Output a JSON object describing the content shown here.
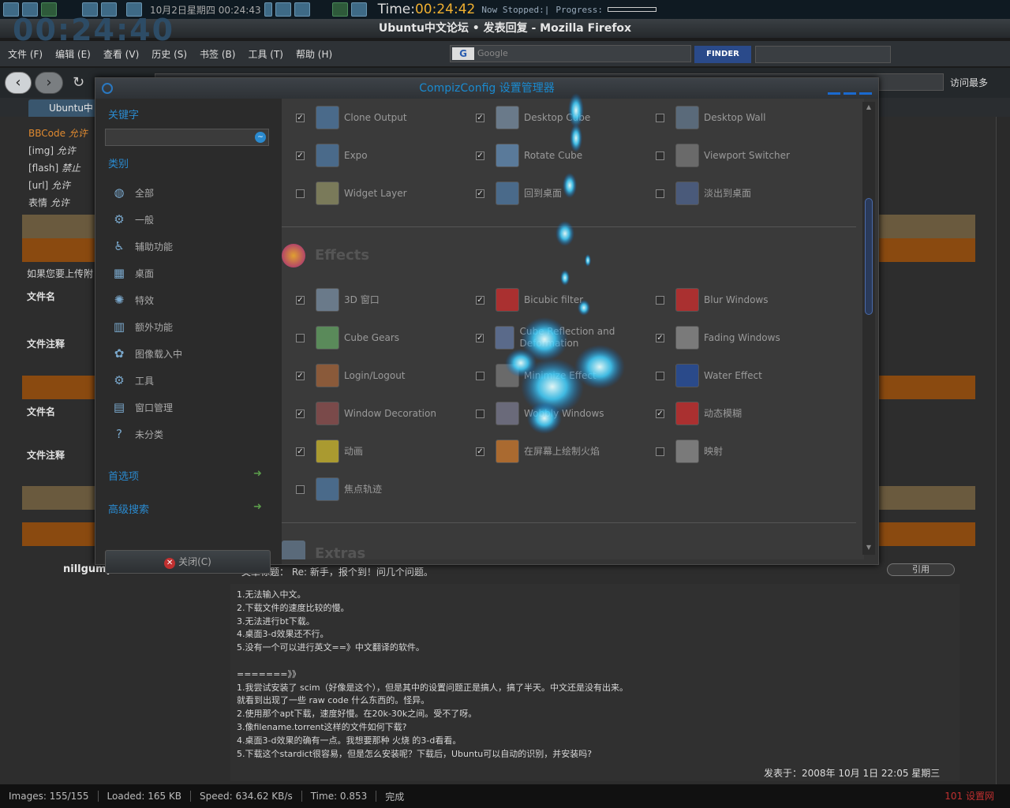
{
  "sys": {
    "clock": "10月2日星期四 00:24:43",
    "time_label": "Time:",
    "time_value": "00:24:42",
    "status": "Now Stopped:|",
    "progress_label": "Progress:"
  },
  "firefox": {
    "title": "Ubuntu中文论坛 • 发表回复 - Mozilla Firefox",
    "bg_clock": "00:24:40",
    "menu": [
      "文件 (F)",
      "编辑 (E)",
      "查看 (V)",
      "历史 (S)",
      "书签 (B)",
      "工具 (T)",
      "帮助 (H)"
    ],
    "search_placeholder": "Google",
    "finder_label": "FINDER",
    "visit_label": "访问最多",
    "tab_label": "Ubuntu中"
  },
  "page": {
    "left_lines": [
      {
        "tag": "BBCode",
        "state": "允许"
      },
      {
        "tag": "[img]",
        "state": "允许"
      },
      {
        "tag": "[flash]",
        "state": "禁止"
      },
      {
        "tag": "[url]",
        "state": "允许"
      },
      {
        "tag": "表情",
        "state": "允许"
      }
    ],
    "upload_prompt": "如果您要上传附",
    "filename_label": "文件名",
    "filenote_label": "文件注释",
    "author": "nillgump",
    "subject": "文章标题： Re: 新手，报个到！问几个问题。",
    "quote_label": "引用",
    "post_lines": [
      "1.无法输入中文。",
      "2.下载文件的速度比较的慢。",
      "3.无法进行bt下载。",
      "4.桌面3-d效果还不行。",
      "5.没有一个可以进行英文==》中文翻译的软件。",
      "",
      "=======》》",
      "1.我尝试安装了 scim（好像是这个），但是其中的设置问题正是搞人，搞了半天。中文还是没有出来。",
      "就看到出现了一些 raw code 什么东西的。怪异。",
      "2.使用那个apt下载，速度好慢。在20k-30k之间。受不了呀。",
      "3.像filename.torrent这样的文件如何下载?",
      "4.桌面3-d效果的确有一点。我想要那种 火烧 的3-d看看。",
      "5.下载这个stardict很容易，但是怎么安装呢？下载后，Ubuntu可以自动的识别，并安装吗?"
    ],
    "posted": "发表于：2008年 10月 1日 22:05 星期三"
  },
  "statusbar": {
    "images": "Images: 155/155",
    "loaded": "Loaded: 165 KB",
    "speed": "Speed: 634.62 KB/s",
    "time": "Time: 0.853",
    "done": "完成",
    "right": "101 设置网"
  },
  "ccsm": {
    "title": "CompizConfig 设置管理器",
    "keyword_label": "关键字",
    "category_label": "类别",
    "categories": [
      {
        "label": "全部",
        "icon": "globe-icon",
        "glyph": "◍"
      },
      {
        "label": "一般",
        "icon": "gear-icon",
        "glyph": "⚙"
      },
      {
        "label": "辅助功能",
        "icon": "accessibility-icon",
        "glyph": "♿"
      },
      {
        "label": "桌面",
        "icon": "desktop-icon",
        "glyph": "▦"
      },
      {
        "label": "特效",
        "icon": "effects-icon",
        "glyph": "✺"
      },
      {
        "label": "额外功能",
        "icon": "extras-icon",
        "glyph": "▥"
      },
      {
        "label": "图像载入中",
        "icon": "image-loading-icon",
        "glyph": "✿"
      },
      {
        "label": "工具",
        "icon": "tools-icon",
        "glyph": "⚙"
      },
      {
        "label": "窗口管理",
        "icon": "window-management-icon",
        "glyph": "▤"
      },
      {
        "label": "未分类",
        "icon": "question-icon",
        "glyph": "?"
      }
    ],
    "preferences_label": "首选项",
    "advanced_search_label": "高级搜索",
    "close_label": "关闭(C)",
    "section_effects": "Effects",
    "section_extras": "Extras",
    "plugins": [
      {
        "label": "Clone Output",
        "checked": true,
        "color": "#4a6a8a"
      },
      {
        "label": "Desktop Cube",
        "checked": true,
        "color": "#6a7a8a"
      },
      {
        "label": "Desktop Wall",
        "checked": false,
        "color": "#5a6a7a"
      },
      {
        "label": "Expo",
        "checked": true,
        "color": "#4a6a8a"
      },
      {
        "label": "Rotate Cube",
        "checked": true,
        "color": "#5a7a9a"
      },
      {
        "label": "Viewport Switcher",
        "checked": false,
        "color": "#6a6a6a"
      },
      {
        "label": "Widget Layer",
        "checked": false,
        "color": "#7a7a5a"
      },
      {
        "label": "回到桌面",
        "checked": true,
        "color": "#4a6a8a"
      },
      {
        "label": "淡出到桌面",
        "checked": false,
        "color": "#4a5a7a"
      },
      {
        "label": "3D 窗口",
        "checked": true,
        "color": "#6a7a8a"
      },
      {
        "label": "Bicubic filter",
        "checked": true,
        "color": "#aa3030"
      },
      {
        "label": "Blur Windows",
        "checked": false,
        "color": "#aa3030"
      },
      {
        "label": "Cube Gears",
        "checked": false,
        "color": "#5a8a5a"
      },
      {
        "label": "Cube Reflection and Deformation",
        "checked": true,
        "color": "#5a6a8a"
      },
      {
        "label": "Fading Windows",
        "checked": true,
        "color": "#7a7a7a"
      },
      {
        "label": "Login/Logout",
        "checked": true,
        "color": "#8a5a3a"
      },
      {
        "label": "Minimize Effect",
        "checked": false,
        "color": "#6a6a6a"
      },
      {
        "label": "Water Effect",
        "checked": false,
        "color": "#2a4a8a"
      },
      {
        "label": "Window Decoration",
        "checked": true,
        "color": "#7a4a4a"
      },
      {
        "label": "Wobbly Windows",
        "checked": false,
        "color": "#6a6a7a"
      },
      {
        "label": "动态模糊",
        "checked": true,
        "color": "#aa3030"
      },
      {
        "label": "动画",
        "checked": true,
        "color": "#aa9a30"
      },
      {
        "label": "在屏幕上绘制火焰",
        "checked": true,
        "color": "#aa6a30"
      },
      {
        "label": "映射",
        "checked": false,
        "color": "#7a7a7a"
      },
      {
        "label": "焦点轨迹",
        "checked": false,
        "color": "#4a6a8a"
      }
    ]
  }
}
